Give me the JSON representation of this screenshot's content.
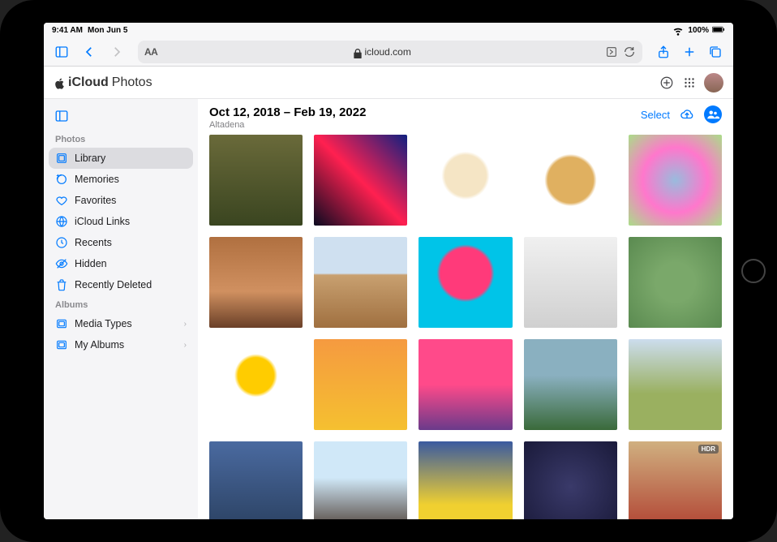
{
  "status": {
    "time": "9:41 AM",
    "date": "Mon Jun 5",
    "battery": "100%"
  },
  "safari": {
    "url": "icloud.com"
  },
  "app": {
    "brand_prefix": "iCloud",
    "brand_suffix": "Photos"
  },
  "sidebar": {
    "section_photos": "Photos",
    "section_albums": "Albums",
    "items": [
      {
        "label": "Library",
        "icon": "library-icon",
        "selected": true,
        "chevron": false
      },
      {
        "label": "Memories",
        "icon": "memories-icon",
        "selected": false,
        "chevron": false
      },
      {
        "label": "Favorites",
        "icon": "heart-icon",
        "selected": false,
        "chevron": false
      },
      {
        "label": "iCloud Links",
        "icon": "link-icon",
        "selected": false,
        "chevron": false
      },
      {
        "label": "Recents",
        "icon": "clock-icon",
        "selected": false,
        "chevron": false
      },
      {
        "label": "Hidden",
        "icon": "eye-icon",
        "selected": false,
        "chevron": false
      },
      {
        "label": "Recently Deleted",
        "icon": "trash-icon",
        "selected": false,
        "chevron": false
      }
    ],
    "album_items": [
      {
        "label": "Media Types",
        "icon": "folder-icon",
        "chevron": true
      },
      {
        "label": "My Albums",
        "icon": "folder-icon",
        "chevron": true
      }
    ]
  },
  "main": {
    "title": "Oct 12, 2018 – Feb 19, 2022",
    "subtitle": "Altadena",
    "select_label": "Select"
  },
  "thumbs": [
    {
      "bg": "linear-gradient(#6a6a3a,#3a4520)",
      "badge": ""
    },
    {
      "bg": "linear-gradient(45deg,#0a0a20,#ff2050,#102080)",
      "badge": ""
    },
    {
      "bg": "radial-gradient(circle at 50% 45%,#f5e5c5 30%,#fff 35%) ,#0a8a55",
      "badge": ""
    },
    {
      "bg": "radial-gradient(circle at 50% 50%,#e0b060 35%,#fff 40%),#a5d000",
      "badge": ""
    },
    {
      "bg": "radial-gradient(circle,#9bd,#f7c,#ad8),#f06",
      "badge": ""
    },
    {
      "bg": "linear-gradient(#b07040,#d09060 60%,#6a4028)",
      "badge": ""
    },
    {
      "bg": "linear-gradient(#cfe0f0 40%,#c8a070 42%,#a07040)",
      "badge": ""
    },
    {
      "bg": "radial-gradient(circle at 50% 40%,#ff3a7a 35%,#00c4e8 40%)",
      "badge": ""
    },
    {
      "bg": "linear-gradient(#f0f0f0,#d0d0d0)",
      "badge": ""
    },
    {
      "bg": "radial-gradient(circle at 50% 50%,#7aa86a 30%,#5a8a50)",
      "badge": ""
    },
    {
      "bg": "radial-gradient(circle at 50% 40%,#ffcc00 25%,#fff 30%)",
      "badge": ""
    },
    {
      "bg": "linear-gradient(#f59a40,#f5c030)",
      "badge": ""
    },
    {
      "bg": "linear-gradient(#ff4a8a 50%,#6a3a8a)",
      "badge": ""
    },
    {
      "bg": "linear-gradient(#8ab0c0 40%,#3a6a3a)",
      "badge": ""
    },
    {
      "bg": "linear-gradient(#cde,#9ab060 60%)",
      "badge": ""
    },
    {
      "bg": "linear-gradient(#4a6aa0,#2a4060)",
      "badge": ""
    },
    {
      "bg": "linear-gradient(#d0e8f8 40%,#4a3a30)",
      "badge": ""
    },
    {
      "bg": "linear-gradient(#3a5aa0,#f0d030 70%)",
      "badge": ""
    },
    {
      "bg": "radial-gradient(circle,#3a3a6a,#1a1a3a)",
      "badge": ""
    },
    {
      "bg": "linear-gradient(#d0b080,#b04030)",
      "badge": "HDR"
    }
  ]
}
